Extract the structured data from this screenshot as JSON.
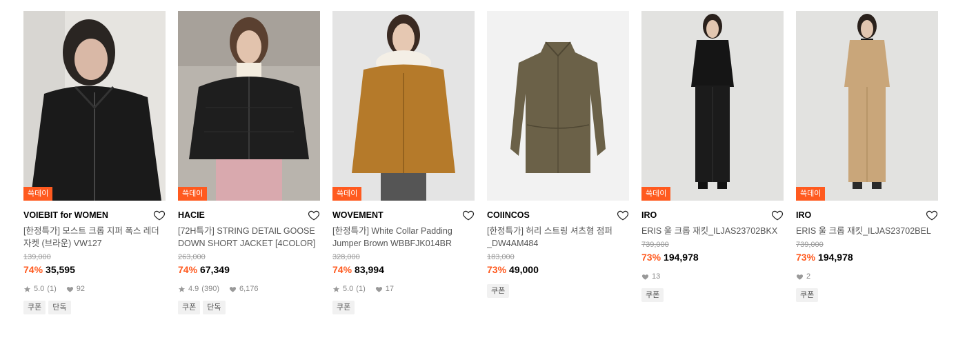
{
  "products": [
    {
      "badge": "쓱데이",
      "brand": "VOIEBIT for WOMEN",
      "name": "[한정특가] 모스트 크롭 지퍼 폭스 레더 자켓 (브라운) VW127",
      "original_price": "139,000",
      "discount": "74%",
      "price": "35,595",
      "rating": "5.0",
      "reviews": "(1)",
      "likes": "92",
      "tags": [
        "쿠폰",
        "단독"
      ]
    },
    {
      "badge": "쓱데이",
      "brand": "HACIE",
      "name": "[72H특가] STRING DETAIL GOOSE DOWN SHORT JACKET [4COLOR]",
      "original_price": "263,000",
      "discount": "74%",
      "price": "67,349",
      "rating": "4.9",
      "reviews": "(390)",
      "likes": "6,176",
      "tags": [
        "쿠폰",
        "단독"
      ]
    },
    {
      "badge": "쓱데이",
      "brand": "WOVEMENT",
      "name": "[한정특가] White Collar Padding Jumper Brown WBBFJK014BR",
      "original_price": "328,000",
      "discount": "74%",
      "price": "83,994",
      "rating": "5.0",
      "reviews": "(1)",
      "likes": "17",
      "tags": [
        "쿠폰"
      ]
    },
    {
      "badge": "",
      "brand": "COIINCOS",
      "name": "[한정특가] 허리 스트링 셔츠형 점퍼 _DW4AM484",
      "original_price": "183,000",
      "discount": "73%",
      "price": "49,000",
      "rating": "",
      "reviews": "",
      "likes": "",
      "tags": [
        "쿠폰"
      ]
    },
    {
      "badge": "쓱데이",
      "brand": "IRO",
      "name": "ERIS 울 크롭 재킷_ILJAS23702BKX",
      "original_price": "739,000",
      "discount": "73%",
      "price": "194,978",
      "rating": "",
      "reviews": "",
      "likes": "13",
      "tags": [
        "쿠폰"
      ]
    },
    {
      "badge": "쓱데이",
      "brand": "IRO",
      "name": "ERIS 울 크롭 재킷_ILJAS23702BEL",
      "original_price": "739,000",
      "discount": "73%",
      "price": "194,978",
      "rating": "",
      "reviews": "",
      "likes": "2",
      "tags": [
        "쿠폰"
      ]
    }
  ],
  "colors": {
    "accent": "#ff5a1f",
    "muted": "#888888"
  }
}
